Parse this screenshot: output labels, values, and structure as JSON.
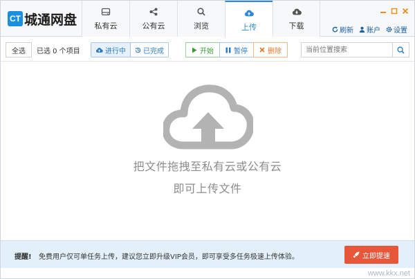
{
  "app": {
    "logo_mark": "CT",
    "logo_text": "城通网盘"
  },
  "nav": {
    "tabs": [
      {
        "label": "私有云",
        "icon": "drive-icon"
      },
      {
        "label": "公有云",
        "icon": "share-icon"
      },
      {
        "label": "浏览",
        "icon": "search-icon"
      },
      {
        "label": "上传",
        "icon": "cloud-upload-icon",
        "active": true
      },
      {
        "label": "下载",
        "icon": "cloud-download-icon"
      }
    ]
  },
  "top_actions": {
    "refresh": "刷新",
    "account": "账户",
    "settings": "设置"
  },
  "toolbar": {
    "select_all": "全选",
    "selected_info": "已选 0 个项目",
    "filter_in_progress": "进行中",
    "filter_done": "已完成",
    "start": "开始",
    "pause": "暂停",
    "delete": "删除",
    "search_placeholder": "当前位置搜索"
  },
  "main": {
    "hint_line1": "把文件拖拽至私有云或公有云",
    "hint_line2": "即可上传文件"
  },
  "notice": {
    "title": "提醒!",
    "text": "免费用户仅可单任务上传，建议您立即升级VIP会员，即可享受多任务极速上传体验。",
    "upgrade_button": "立即提速"
  },
  "watermark": "www.kkx.net",
  "colors": {
    "accent": "#2e8ad8",
    "logo": "#1a8fe0",
    "start": "#3a9a3a",
    "delete": "#e07a2e",
    "upgrade": "#e8563a",
    "notice_bg": "#e3f0fa"
  }
}
